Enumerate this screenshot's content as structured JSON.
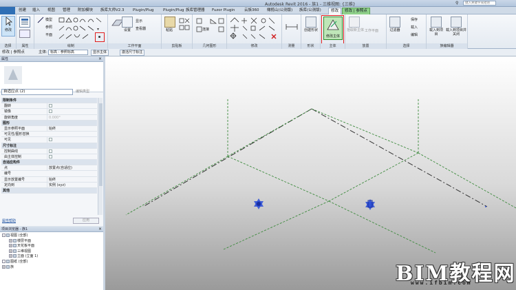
{
  "titlebar": {
    "title": "Autodesk Revit 2016 -   族1 - 三维视图: {三维}",
    "search_placeholder": "键入关键字或短语"
  },
  "tabs": [
    "创建",
    "插入",
    "视图",
    "管理",
    "附加模块",
    "族库大师V2.3",
    "Plugin/Plug",
    "Plugin/Plug",
    "族库管理器",
    "Fuzor Plugin",
    "云族360",
    "橄榄山(公测版)",
    "族库(公测版)",
    "修改",
    "修改 | 参照点"
  ],
  "ribbon": {
    "panels": [
      "选择",
      "属性",
      "绘制",
      "工作平面",
      "剪贴板",
      "几何图形",
      "修改",
      "测量",
      "形状",
      "主体",
      "放置",
      "选择",
      "族编辑器"
    ],
    "modify_label": "修改",
    "draw_items": [
      "模型",
      "参照",
      "平面"
    ],
    "workplane_items": [
      "显示",
      "设置",
      "查看器"
    ],
    "clipboard_items": [
      "粘贴"
    ],
    "geometry_items": [
      "连接"
    ],
    "measure_items": [],
    "shape_items": [
      "创建形状"
    ],
    "host_item": "修改主体",
    "place_items": [
      "拾取新主体",
      "工作平面"
    ],
    "select_items": [
      "过滤器",
      "保存",
      "载入",
      "编辑"
    ],
    "family_editor_items": [
      "载入到项目",
      "载入到项目并关闭"
    ],
    "highlighted_button": "修改图元"
  },
  "optionsbar": {
    "context": "修改 | 参照点",
    "host_label": "主体:",
    "host_value": "标高 : 参照标高",
    "show_host": "显示主体",
    "dim_label": "激活尺寸标注"
  },
  "properties": {
    "title": "属性",
    "type_name": "自适应点 (2)",
    "edit_type": "编辑类型",
    "rows": [
      {
        "group": "限制条件"
      },
      {
        "k": "翻转",
        "v": "",
        "check": true,
        "gray": true
      },
      {
        "k": "镜像",
        "v": "",
        "check": true,
        "gray": true
      },
      {
        "k": "旋转角度",
        "v": "0.000°",
        "gray": true
      },
      {
        "group": "图形"
      },
      {
        "k": "显示参照平面",
        "v": "始终"
      },
      {
        "k": "可见性/图形替换",
        "v": "编辑...",
        "button": true
      },
      {
        "k": "可见",
        "v": "",
        "check": true
      },
      {
        "group": "尺寸标注"
      },
      {
        "k": "控制曲线",
        "v": "",
        "check": true,
        "gray": true
      },
      {
        "k": "由主体控制",
        "v": "",
        "check": true,
        "gray": true
      },
      {
        "group": "自适应构件"
      },
      {
        "k": "点",
        "v": "放置点(自适应)"
      },
      {
        "k": "编号",
        "v": ""
      },
      {
        "k": "显示放置编号",
        "v": "始终"
      },
      {
        "k": "定向到",
        "v": "实例 (xyz)"
      },
      {
        "group": "其他"
      }
    ],
    "help_link": "属性帮助",
    "apply": "应用"
  },
  "browser": {
    "title": "项目浏览器 - 族1",
    "items": [
      {
        "label": "视图 (全部)",
        "level": 0,
        "sign": "-"
      },
      {
        "label": "楼层平面",
        "level": 1,
        "sign": "+"
      },
      {
        "label": "天花板平面",
        "level": 1,
        "sign": "+"
      },
      {
        "label": "三维视图",
        "level": 1,
        "sign": "+"
      },
      {
        "label": "立面 (立面 1)",
        "level": 1,
        "sign": "+"
      },
      {
        "label": "图纸 (全部)",
        "level": 0,
        "sign": ""
      },
      {
        "label": "族",
        "level": 0,
        "sign": "+"
      }
    ]
  },
  "watermark": {
    "text": "BIM教程网",
    "url": "www.ifbim.com"
  }
}
